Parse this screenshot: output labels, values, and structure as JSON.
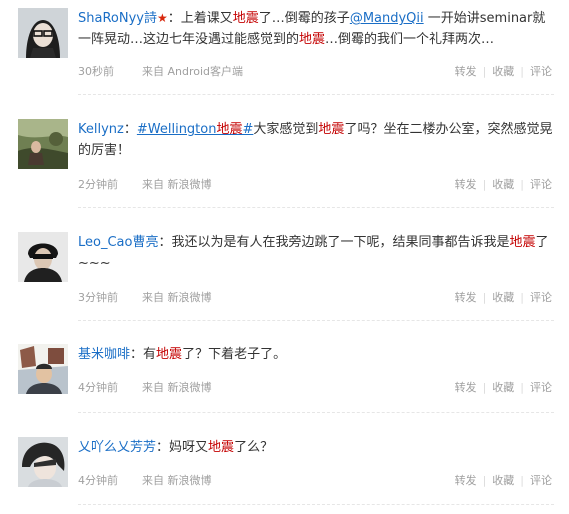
{
  "posts": [
    {
      "user": "ShaRoNyy詩",
      "badge": "★",
      "colon": "：",
      "segments": [
        {
          "t": "上着课又",
          "c": "text"
        },
        {
          "t": "地震",
          "c": "quake"
        },
        {
          "t": "了…倒霉的孩子",
          "c": "text"
        },
        {
          "t": "@MandyQii",
          "c": "mention"
        },
        {
          "t": " 一开始讲seminar就一阵晃动…这边七年没遇过能感觉到的",
          "c": "text"
        },
        {
          "t": "地震",
          "c": "quake"
        },
        {
          "t": "…倒霉的我们一个礼拜两次…",
          "c": "text"
        }
      ],
      "time": "30秒前",
      "source_prefix": "来自",
      "source": "Android客户端"
    },
    {
      "user": "Kellynz",
      "badge": "",
      "colon": "：",
      "segments": [
        {
          "t": "#Wellington",
          "c": "topic"
        },
        {
          "t": "地震",
          "c": "quake"
        },
        {
          "t": "#",
          "c": "topic"
        },
        {
          "t": "大家感觉到",
          "c": "text"
        },
        {
          "t": "地震",
          "c": "quake"
        },
        {
          "t": "了吗？坐在二楼办公室，突然感觉晃的厉害！",
          "c": "text"
        }
      ],
      "time": "2分钟前",
      "source_prefix": "来自",
      "source": "新浪微博"
    },
    {
      "user": "Leo_Cao曹亮",
      "badge": "",
      "colon": "：",
      "segments": [
        {
          "t": "我还以为是有人在我旁边跳了一下呢，结果同事都告诉我是",
          "c": "text"
        },
        {
          "t": "地震",
          "c": "quake"
        },
        {
          "t": "了~~~",
          "c": "text"
        }
      ],
      "time": "3分钟前",
      "source_prefix": "来自",
      "source": "新浪微博"
    },
    {
      "user": "基米咖啡",
      "badge": "",
      "colon": "：",
      "segments": [
        {
          "t": "有",
          "c": "text"
        },
        {
          "t": "地震",
          "c": "quake"
        },
        {
          "t": "了？下着老子了。",
          "c": "text"
        }
      ],
      "time": "4分钟前",
      "source_prefix": "来自",
      "source": "新浪微博"
    },
    {
      "user": "乂吖么乂芳芳",
      "badge": "",
      "colon": "：",
      "segments": [
        {
          "t": "妈呀又",
          "c": "text"
        },
        {
          "t": "地震",
          "c": "quake"
        },
        {
          "t": "了么？",
          "c": "text"
        }
      ],
      "time": "4分钟前",
      "source_prefix": "来自",
      "source": "新浪微博"
    }
  ],
  "actions": {
    "forward": "转发",
    "favorite": "收藏",
    "comment": "评论",
    "separator": "|"
  }
}
